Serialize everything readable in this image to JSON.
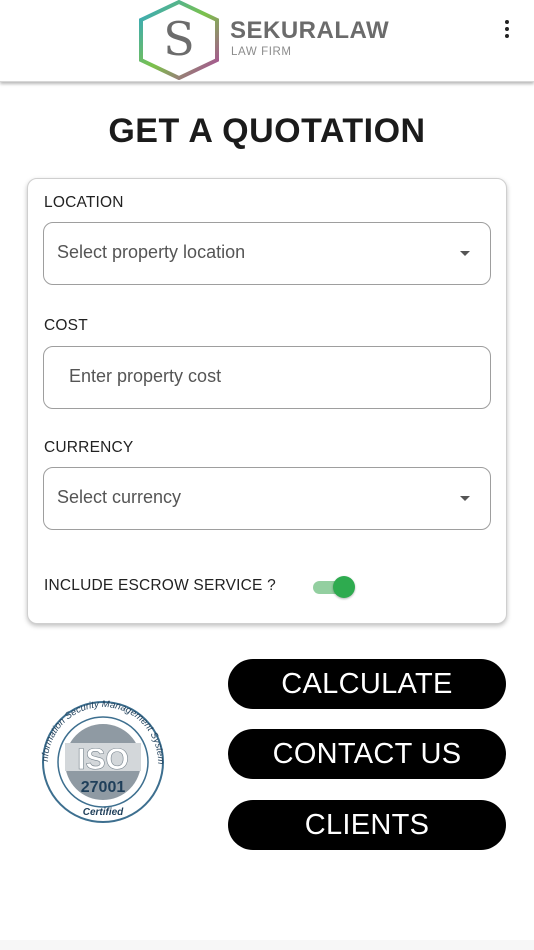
{
  "header": {
    "logo_letter": "S",
    "brand_name": "SEKURALAW",
    "brand_subtitle": "LAW FIRM",
    "menu_icon": "kebab-menu-icon"
  },
  "page": {
    "title": "GET A QUOTATION"
  },
  "form": {
    "location": {
      "label": "LOCATION",
      "placeholder": "Select property location"
    },
    "cost": {
      "label": "COST",
      "placeholder": "Enter property cost"
    },
    "currency": {
      "label": "CURRENCY",
      "placeholder": "Select currency"
    },
    "escrow": {
      "label": "INCLUDE ESCROW SERVICE ?",
      "enabled": true
    }
  },
  "actions": {
    "calculate": "CALCULATE",
    "contact": "CONTACT US",
    "clients": "CLIENTS"
  },
  "badge": {
    "ring_text": "Information Security Management System",
    "iso": "ISO",
    "number": "27001",
    "certified": "Certified"
  },
  "colors": {
    "toggle_on": "#2eab4f",
    "button_bg": "#000000"
  }
}
